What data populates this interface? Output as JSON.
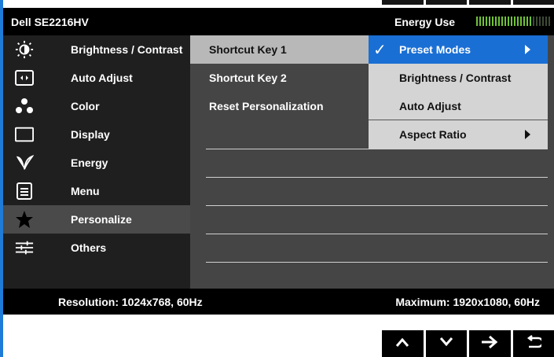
{
  "header": {
    "model": "Dell SE2216HV",
    "energy_label": "Energy Use",
    "energy_level": 0.77
  },
  "categories": [
    {
      "label": "Brightness / Contrast",
      "icon": "brightness-icon"
    },
    {
      "label": "Auto Adjust",
      "icon": "auto-adjust-icon"
    },
    {
      "label": "Color",
      "icon": "color-icon"
    },
    {
      "label": "Display",
      "icon": "display-icon"
    },
    {
      "label": "Energy",
      "icon": "energy-icon"
    },
    {
      "label": "Menu",
      "icon": "menu-icon"
    },
    {
      "label": "Personalize",
      "icon": "star-icon",
      "selected": true
    },
    {
      "label": "Others",
      "icon": "sliders-icon"
    }
  ],
  "submenu": [
    {
      "label": "Shortcut Key 1",
      "selected": true
    },
    {
      "label": "Shortcut Key 2"
    },
    {
      "label": "Reset Personalization"
    }
  ],
  "options": [
    {
      "label": "Preset Modes",
      "selected": true,
      "checked": true,
      "has_submenu": true
    },
    {
      "label": "Brightness / Contrast"
    },
    {
      "label": "Auto Adjust"
    },
    {
      "label": "Aspect Ratio",
      "has_submenu": true
    }
  ],
  "footer": {
    "resolution": "Resolution: 1024x768, 60Hz",
    "maximum": "Maximum: 1920x1080, 60Hz"
  },
  "nav_buttons": [
    "up-arrow-icon",
    "down-arrow-icon",
    "right-arrow-icon",
    "back-arrow-icon"
  ],
  "colors": {
    "accent": "#1a6fd4",
    "energy_bar": "#6fc23a"
  }
}
